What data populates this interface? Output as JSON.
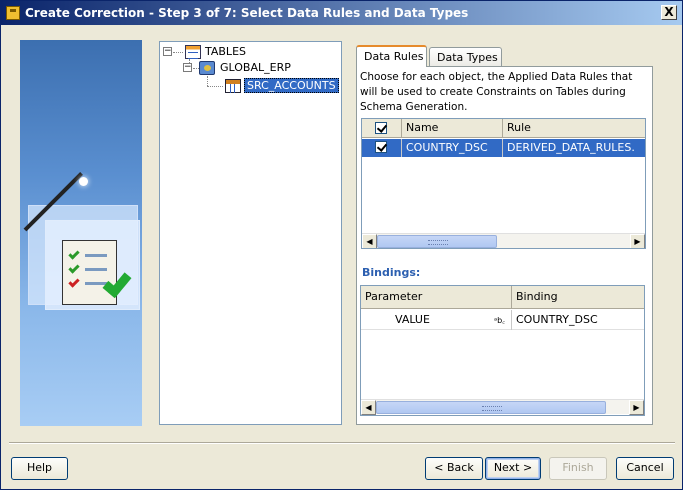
{
  "window": {
    "title": "Create Correction - Step 3 of 7: Select Data Rules and Data Types",
    "close_symbol": "X"
  },
  "tree": {
    "root": {
      "label": "TABLES",
      "icon": "tables-folder-icon",
      "expanded": true
    },
    "module": {
      "label": "GLOBAL_ERP",
      "icon": "module-icon",
      "expanded": true
    },
    "table": {
      "label": "SRC_ACCOUNTS",
      "icon": "table-icon",
      "selected": true
    }
  },
  "tabs": [
    {
      "label": "Data Rules",
      "active": true
    },
    {
      "label": "Data Types",
      "active": false
    }
  ],
  "instructions": "Choose for each object, the Applied Data Rules that will be used to create Constraints on Tables during Schema Generation.",
  "rules_table": {
    "columns": [
      "",
      "Name",
      "Rule"
    ],
    "header_checked": true,
    "rows": [
      {
        "checked": true,
        "name": "COUNTRY_DSC",
        "rule": "DERIVED_DATA_RULES."
      }
    ]
  },
  "bindings": {
    "label": "Bindings:",
    "columns": [
      "Parameter",
      "Binding"
    ],
    "rows": [
      {
        "parameter": "VALUE",
        "type_icon": "abc-icon",
        "binding": "COUNTRY_DSC"
      }
    ]
  },
  "buttons": {
    "help": "Help",
    "back": "< Back",
    "next": "Next >",
    "finish": "Finish",
    "cancel": "Cancel"
  },
  "colors": {
    "title_gradient_start": "#0a246a",
    "selection": "#316ac5",
    "bindings_label": "#2c5fb0"
  }
}
